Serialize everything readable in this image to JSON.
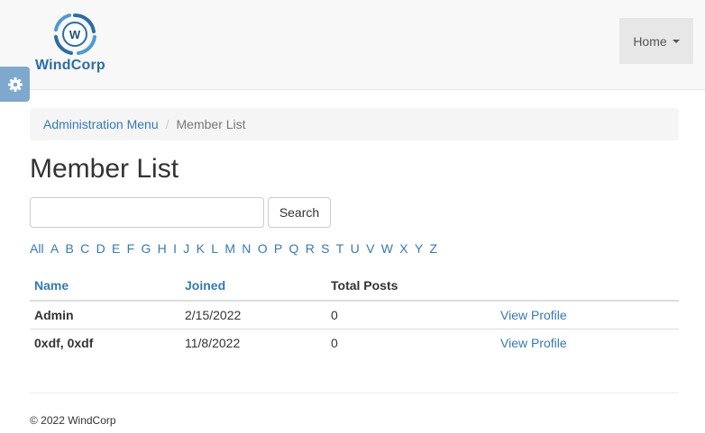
{
  "brand": {
    "name": "WindCorp",
    "logo_letter": "W",
    "color": "#2a6ea8"
  },
  "nav": {
    "home_label": "Home"
  },
  "breadcrumb": {
    "parent": "Administration Menu",
    "separator": "/",
    "current": "Member List"
  },
  "page": {
    "title": "Member List"
  },
  "search": {
    "value": "",
    "placeholder": "",
    "button_label": "Search"
  },
  "alphabet": [
    "All",
    "A",
    "B",
    "C",
    "D",
    "E",
    "F",
    "G",
    "H",
    "I",
    "J",
    "K",
    "L",
    "M",
    "N",
    "O",
    "P",
    "Q",
    "R",
    "S",
    "T",
    "U",
    "V",
    "W",
    "X",
    "Y",
    "Z"
  ],
  "table": {
    "headers": {
      "name": "Name",
      "joined": "Joined",
      "posts": "Total Posts"
    },
    "rows": [
      {
        "name": "Admin",
        "joined": "2/15/2022",
        "posts": "0",
        "action": "View Profile"
      },
      {
        "name": "0xdf, 0xdf",
        "joined": "11/8/2022",
        "posts": "0",
        "action": "View Profile"
      }
    ]
  },
  "footer": {
    "text": "© 2022 WindCorp"
  },
  "colors": {
    "link": "#337ab7",
    "navbar_bg": "#f8f8f8",
    "gear_tab": "#7fa8cf"
  },
  "icons": {
    "settings_tab": "gear-icon",
    "logo": "wind-swirl-logo-icon"
  }
}
